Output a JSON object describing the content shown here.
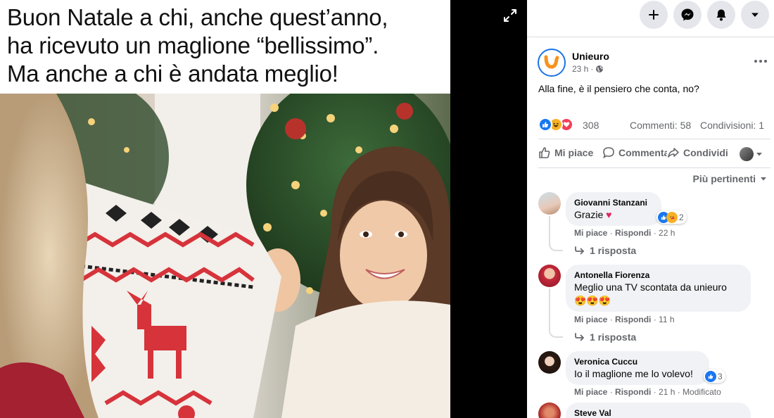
{
  "media": {
    "caption_lines": [
      "Buon Natale a chi, anche quest’anno,",
      "ha ricevuto un maglione “bellissimo”.",
      "Ma anche a chi è andata meglio!"
    ]
  },
  "post": {
    "page_name": "Unieuro",
    "time": "23 h",
    "text": "Alla fine, è il pensiero che conta, no?",
    "reactions_count": "308",
    "comments_count": "Commenti: 58",
    "shares_count": "Condivisioni: 1",
    "actions": {
      "like": "Mi piace",
      "comment": "Commenta",
      "share": "Condividi"
    },
    "sort_label": "Più pertinenti"
  },
  "comments": [
    {
      "name": "Giovanni Stanzani",
      "text": "Grazie",
      "emoji": "♥",
      "reactions": "2",
      "like": "Mi piace",
      "reply": "Rispondi",
      "time": "22 h",
      "replies": "1 risposta"
    },
    {
      "name": "Antonella Fiorenza",
      "text": "Meglio una TV scontata da unieuro",
      "emoji": "😍😍😍",
      "like": "Mi piace",
      "reply": "Rispondi",
      "time": "11 h",
      "replies": "1 risposta"
    },
    {
      "name": "Veronica Cuccu",
      "text": "Io il maglione me lo volevo!",
      "reactions": "3",
      "like": "Mi piace",
      "reply": "Rispondi",
      "time": "21 h",
      "edited": "Modificato"
    },
    {
      "name": "Steve Val"
    }
  ],
  "colors": {
    "brand_blue": "#1877f2",
    "unieuro_orange": "#f7931e",
    "secondary_text": "#65676b",
    "bubble_bg": "#f0f2f5"
  },
  "icons": {
    "expand": "expand-icon",
    "plus": "plus-icon",
    "messenger": "messenger-icon",
    "notifications": "bell-icon",
    "account": "chevron-down-icon",
    "globe": "globe-icon",
    "more": "more-icon"
  }
}
